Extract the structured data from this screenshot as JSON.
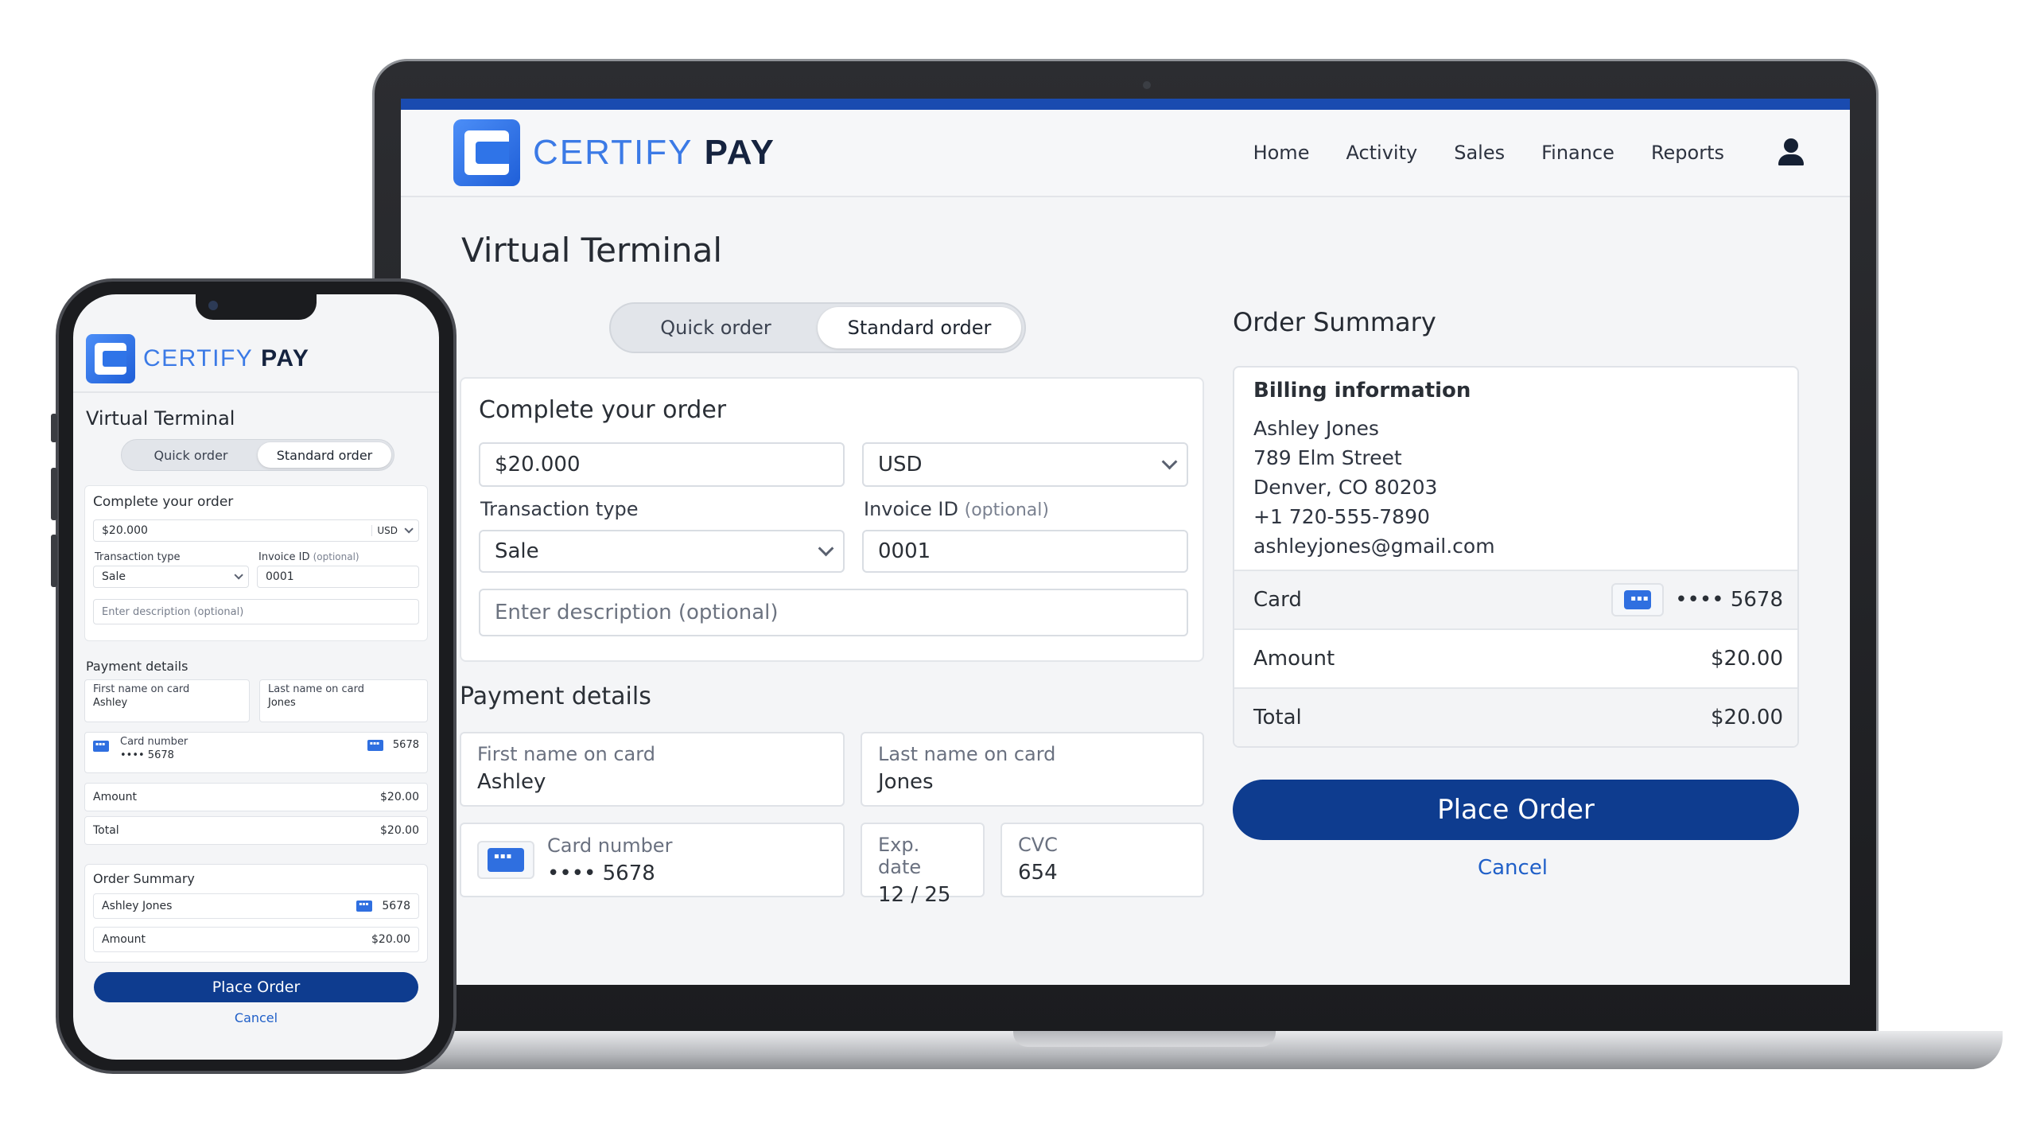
{
  "brand": {
    "name_part1": "CERTIFY",
    "name_part2": "PAY"
  },
  "nav": {
    "home": "Home",
    "activity": "Activity",
    "sales": "Sales",
    "finance": "Finance",
    "reports": "Reports"
  },
  "page_title": "Virtual Terminal",
  "order_tabs": {
    "quick": "Quick order",
    "standard": "Standard order",
    "active": "standard"
  },
  "complete_order": {
    "heading": "Complete your order",
    "amount": "$20.000",
    "currency": "USD",
    "transaction_type_label": "Transaction type",
    "transaction_type": "Sale",
    "invoice_label": "Invoice ID",
    "invoice_optional": "(optional)",
    "invoice_id": "0001",
    "description_placeholder": "Enter description (optional)"
  },
  "payment_details": {
    "heading": "Payment details",
    "first_name_label": "First name on card",
    "first_name": "Ashley",
    "last_name_label": "Last name on card",
    "last_name": "Jones",
    "card_number_label": "Card number",
    "card_number_masked": "•••• 5678",
    "exp_label": "Exp. date",
    "exp": "12 / 25",
    "cvc_label": "CVC",
    "cvc": "654"
  },
  "order_summary": {
    "heading": "Order Summary",
    "billing_heading": "Billing information",
    "name": "Ashley Jones",
    "street": "789 Elm Street",
    "city": "Denver, CO 80203",
    "phone": "+1 720-555-7890",
    "email": "ashleyjones@gmail.com",
    "card_label": "Card",
    "card_masked": "•••• 5678",
    "amount_label": "Amount",
    "amount": "$20.00",
    "total_label": "Total",
    "total": "$20.00"
  },
  "actions": {
    "place_order": "Place Order",
    "cancel": "Cancel"
  },
  "mobile": {
    "card_number_masked": "•••• 5678",
    "card_last4": "5678",
    "summary_name": "Ashley Jones"
  },
  "colors": {
    "primary": "#0e3c8f",
    "accent": "#2f6fe0",
    "link": "#1f5fc8",
    "top_bar": "#1a4bb0"
  }
}
